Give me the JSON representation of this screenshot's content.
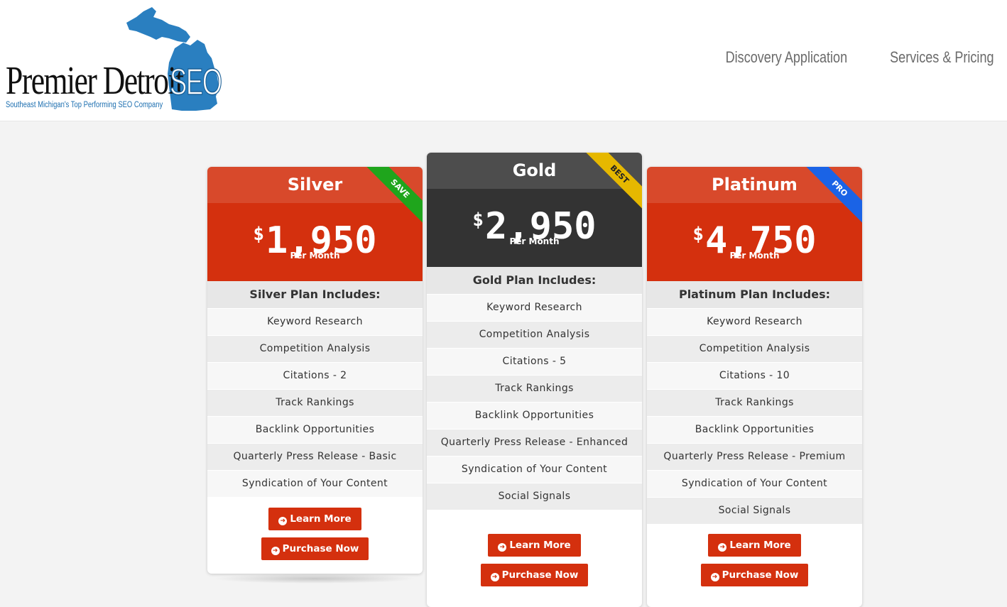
{
  "header": {
    "logo_word": "Premier Detroit",
    "logo_seo": "SEO",
    "logo_tagline": "Southeast Michigan's Top Performing SEO Company",
    "nav": [
      "Discovery Application",
      "Services & Pricing"
    ]
  },
  "plans": [
    {
      "name": "Silver",
      "ribbon": "SAVE",
      "currency": "$",
      "price": "1,950",
      "period": "Per Month",
      "includes": "Silver Plan Includes:",
      "features": [
        "Keyword Research",
        "Competition Analysis",
        "Citations - 2",
        "Track Rankings",
        "Backlink Opportunities",
        "Quarterly Press Release - Basic",
        "Syndication of Your Content"
      ],
      "learn_more": "Learn More",
      "purchase": "Purchase Now"
    },
    {
      "name": "Gold",
      "ribbon": "BEST",
      "currency": "$",
      "price": "2,950",
      "period": "Per Month",
      "includes": "Gold Plan Includes:",
      "features": [
        "Keyword Research",
        "Competition Analysis",
        "Citations - 5",
        "Track Rankings",
        "Backlink Opportunities",
        "Quarterly Press Release - Enhanced",
        "Syndication of Your Content",
        "Social Signals"
      ],
      "learn_more": "Learn More",
      "purchase": "Purchase Now"
    },
    {
      "name": "Platinum",
      "ribbon": "PRO",
      "currency": "$",
      "price": "4,750",
      "period": "Per Month",
      "includes": "Platinum Plan Includes:",
      "features": [
        "Keyword Research",
        "Competition Analysis",
        "Citations - 10",
        "Track Rankings",
        "Backlink Opportunities",
        "Quarterly Press Release - Premium",
        "Syndication of Your Content",
        "Social Signals"
      ],
      "learn_more": "Learn More",
      "purchase": "Purchase Now"
    }
  ],
  "colors": {
    "accent": "#d4300e",
    "title_red": "#d8492b",
    "gold_dark": "#333333",
    "ribbon_save": "#1fa51c",
    "ribbon_best": "#e6b800",
    "ribbon_pro": "#1a63e6"
  }
}
